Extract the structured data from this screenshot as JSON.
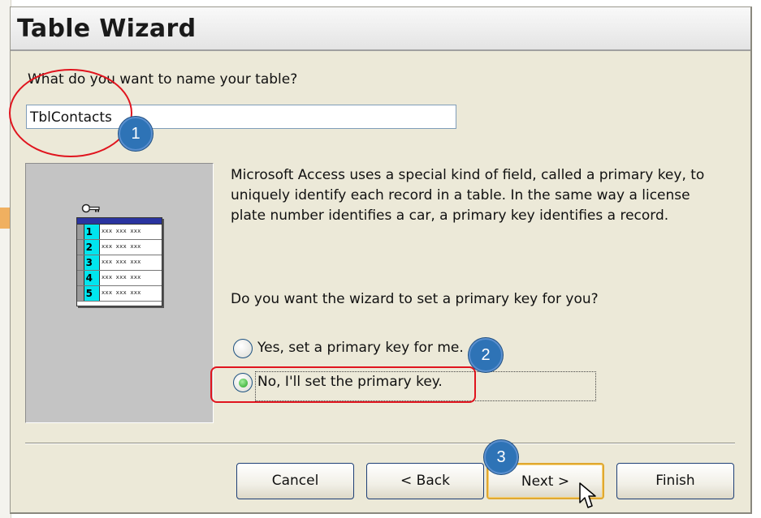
{
  "dialog": {
    "title": "Table Wizard",
    "name_prompt": "What do you want to name your table?",
    "table_name_value": "TblContacts",
    "description": "Microsoft Access uses a special kind of field, called a primary key, to uniquely identify each record in a table. In the same way a license plate number identifies a car, a primary key identifies a record.",
    "question": "Do you want the wizard to set a primary key for you?",
    "options": [
      {
        "label": "Yes, set a primary key for me.",
        "selected": false
      },
      {
        "label": "No, I'll set the primary key.",
        "selected": true
      }
    ],
    "buttons": {
      "cancel": "Cancel",
      "back": "< Back",
      "next": "Next >",
      "finish": "Finish"
    }
  },
  "illustration": {
    "rows": [
      {
        "num": "1",
        "cells": "xxx xxx xxx"
      },
      {
        "num": "2",
        "cells": "xxx xxx xxx"
      },
      {
        "num": "3",
        "cells": "xxx xxx xxx"
      },
      {
        "num": "4",
        "cells": "xxx xxx xxx"
      },
      {
        "num": "5",
        "cells": "xxx xxx xxx"
      }
    ]
  },
  "annotations": {
    "badge_1": "1",
    "badge_2": "2",
    "badge_3": "3",
    "highlight_color": "#e0141e",
    "badge_color": "#2e73b6"
  }
}
